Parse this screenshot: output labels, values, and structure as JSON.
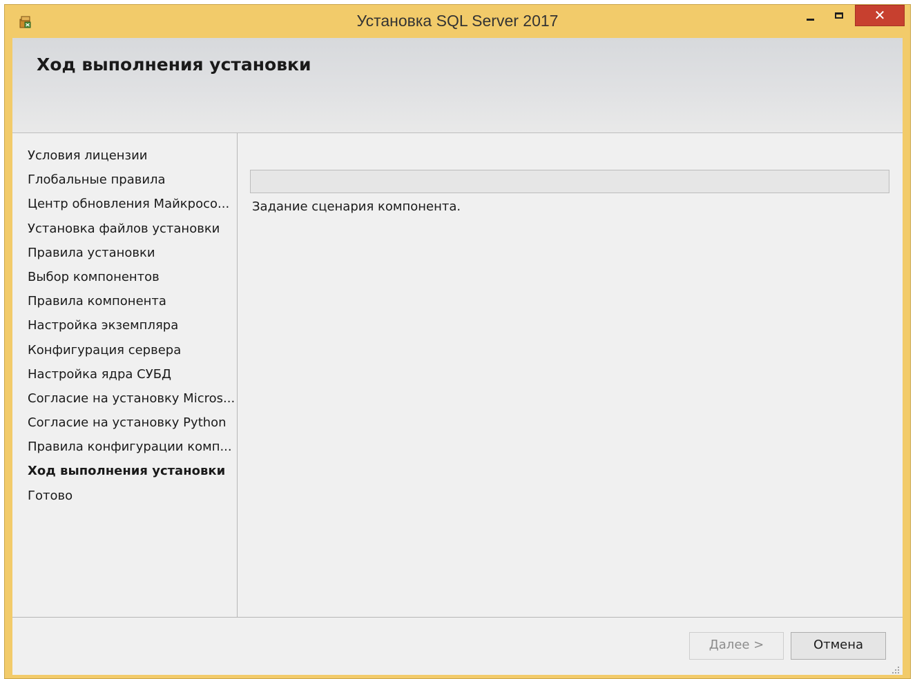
{
  "window": {
    "title": "Установка SQL Server 2017",
    "close_glyph": "✕",
    "colors": {
      "frame": "#f2cb6a",
      "close": "#c7402f",
      "progress": "#06b025"
    }
  },
  "header": {
    "title": "Ход выполнения установки"
  },
  "sidebar": {
    "items": [
      {
        "label": "Условия лицензии",
        "active": false
      },
      {
        "label": "Глобальные правила",
        "active": false
      },
      {
        "label": "Центр обновления Майкросо...",
        "active": false
      },
      {
        "label": "Установка файлов установки",
        "active": false
      },
      {
        "label": "Правила установки",
        "active": false
      },
      {
        "label": "Выбор компонентов",
        "active": false
      },
      {
        "label": "Правила компонента",
        "active": false
      },
      {
        "label": "Настройка экземпляра",
        "active": false
      },
      {
        "label": "Конфигурация сервера",
        "active": false
      },
      {
        "label": "Настройка ядра СУБД",
        "active": false
      },
      {
        "label": "Согласие на установку Micros...",
        "active": false
      },
      {
        "label": "Согласие на установку Python",
        "active": false
      },
      {
        "label": "Правила конфигурации комп...",
        "active": false
      },
      {
        "label": "Ход выполнения установки",
        "active": true
      },
      {
        "label": "Готово",
        "active": false
      }
    ]
  },
  "main": {
    "progress": 0,
    "status_text": "Задание сценария компонента."
  },
  "footer": {
    "next_accel": "Д",
    "next_rest": "алее >",
    "next_enabled": false,
    "cancel_label": "Отмена"
  },
  "icons": {
    "app": "sql-setup-icon",
    "minimize": "minimize-icon",
    "maximize": "maximize-icon",
    "close": "close-icon",
    "grip": "resize-grip-icon"
  }
}
